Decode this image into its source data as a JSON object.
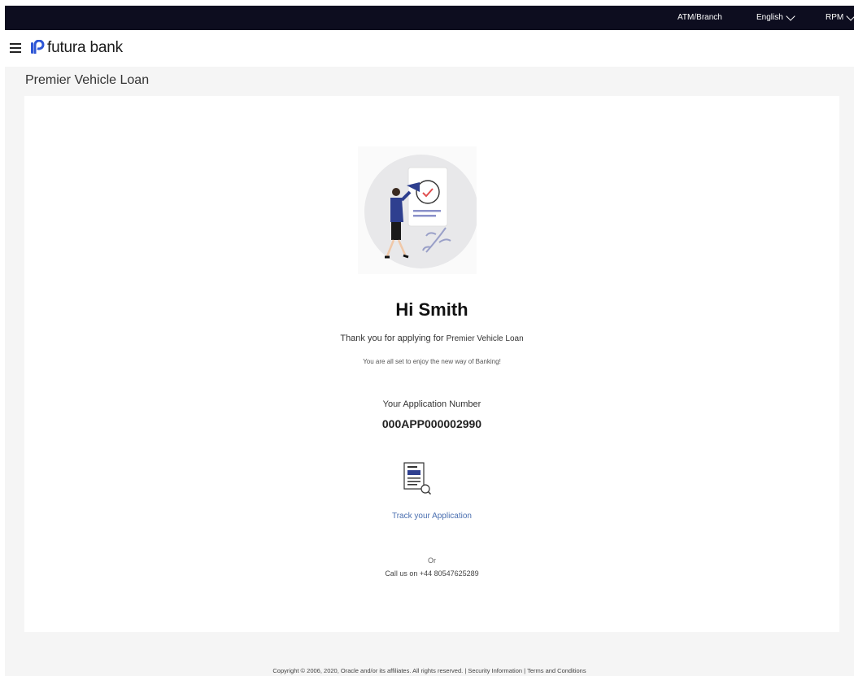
{
  "topbar": {
    "atm_branch": "ATM/Branch",
    "language": "English",
    "user": "RPM"
  },
  "header": {
    "brand": "futura bank"
  },
  "page": {
    "title": "Premier Vehicle Loan"
  },
  "confirmation": {
    "greeting": "Hi Smith",
    "thanks_prefix": "Thank you for applying for",
    "product": "Premier Vehicle Loan",
    "tagline": "You are all set to enjoy the new way of Banking!",
    "application_label": "Your Application Number",
    "application_number": "000APP000002990",
    "track_link": "Track your Application",
    "or_text": "Or",
    "call_text": "Call us on +44 80547625289"
  },
  "footer": {
    "copyright": "Copyright © 2006, 2020, Oracle and/or its affiliates. All rights reserved.",
    "security": "Security Information",
    "terms": "Terms and Conditions",
    "separator": "|"
  },
  "colors": {
    "topbar": "#0d0d1f",
    "link": "#4a6fb0",
    "illustration_accent": "#2e3f8f"
  }
}
